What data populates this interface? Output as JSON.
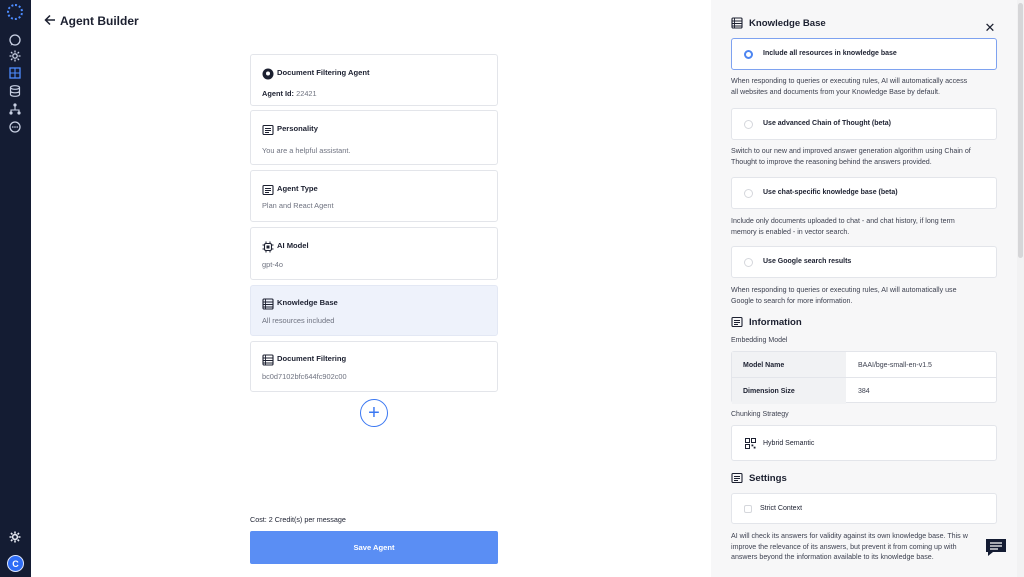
{
  "sidebar": {
    "icons": [
      "logo-icon",
      "chat-icon",
      "gear-icon",
      "grid-icon",
      "database-icon",
      "hierarchy-icon",
      "chat-dots-icon"
    ],
    "bottom_icon": "gear-icon",
    "avatar_letter": "C"
  },
  "header": {
    "title": "Agent Builder"
  },
  "agent": {
    "name": "Document Filtering Agent",
    "id_label": "Agent Id:",
    "id_value": "22421"
  },
  "cards": [
    {
      "title": "Personality",
      "subtitle": "You are a helpful assistant."
    },
    {
      "title": "Agent Type",
      "subtitle": "Plan and React Agent"
    },
    {
      "title": "AI Model",
      "subtitle": "gpt-4o"
    },
    {
      "title": "Knowledge Base",
      "subtitle": "All resources included"
    },
    {
      "title": "Document Filtering",
      "subtitle": "bc0d7102bfc644fc902c00"
    }
  ],
  "footer": {
    "cost": "Cost: 2 Credit(s) per message",
    "save_label": "Save Agent"
  },
  "panel": {
    "title": "Knowledge Base",
    "options": [
      {
        "label": "Include all resources in knowledge base",
        "selected": true,
        "desc1": "When responding to queries or executing rules, AI will automatically access",
        "desc2": "all websites and documents from your Knowledge Base by default."
      },
      {
        "label": "Use advanced Chain of Thought (beta)",
        "selected": false,
        "desc1": "Switch to our new and improved answer generation algorithm using Chain of",
        "desc2": "Thought to improve the reasoning behind the answers provided."
      },
      {
        "label": "Use chat-specific knowledge base (beta)",
        "selected": false,
        "desc1": "Include only documents uploaded to chat - and chat history, if long term",
        "desc2": "memory is enabled - in vector search."
      },
      {
        "label": "Use Google search results",
        "selected": false,
        "desc1": "When responding to queries or executing rules, AI will automatically use",
        "desc2": "Google to search for more information."
      }
    ],
    "information": {
      "title": "Information",
      "embedding_label": "Embedding Model",
      "rows": [
        {
          "key": "Model Name",
          "value": "BAAI/bge-small-en-v1.5"
        },
        {
          "key": "Dimension Size",
          "value": "384"
        }
      ],
      "chunking_label": "Chunking Strategy",
      "chunking_value": "Hybrid Semantic"
    },
    "settings": {
      "title": "Settings",
      "strict_label": "Strict Context",
      "desc1": "AI will check its answers for validity against its own knowledge base. This w",
      "desc2": "improve the relevance of its answers, but prevent it from coming up with",
      "desc3": "answers beyond the information available to its knowledge base."
    }
  },
  "colors": {
    "rail": "#141c33",
    "accent": "#3b78f2",
    "save_button": "#5a8ef4",
    "active_card": "#eef2fb"
  }
}
